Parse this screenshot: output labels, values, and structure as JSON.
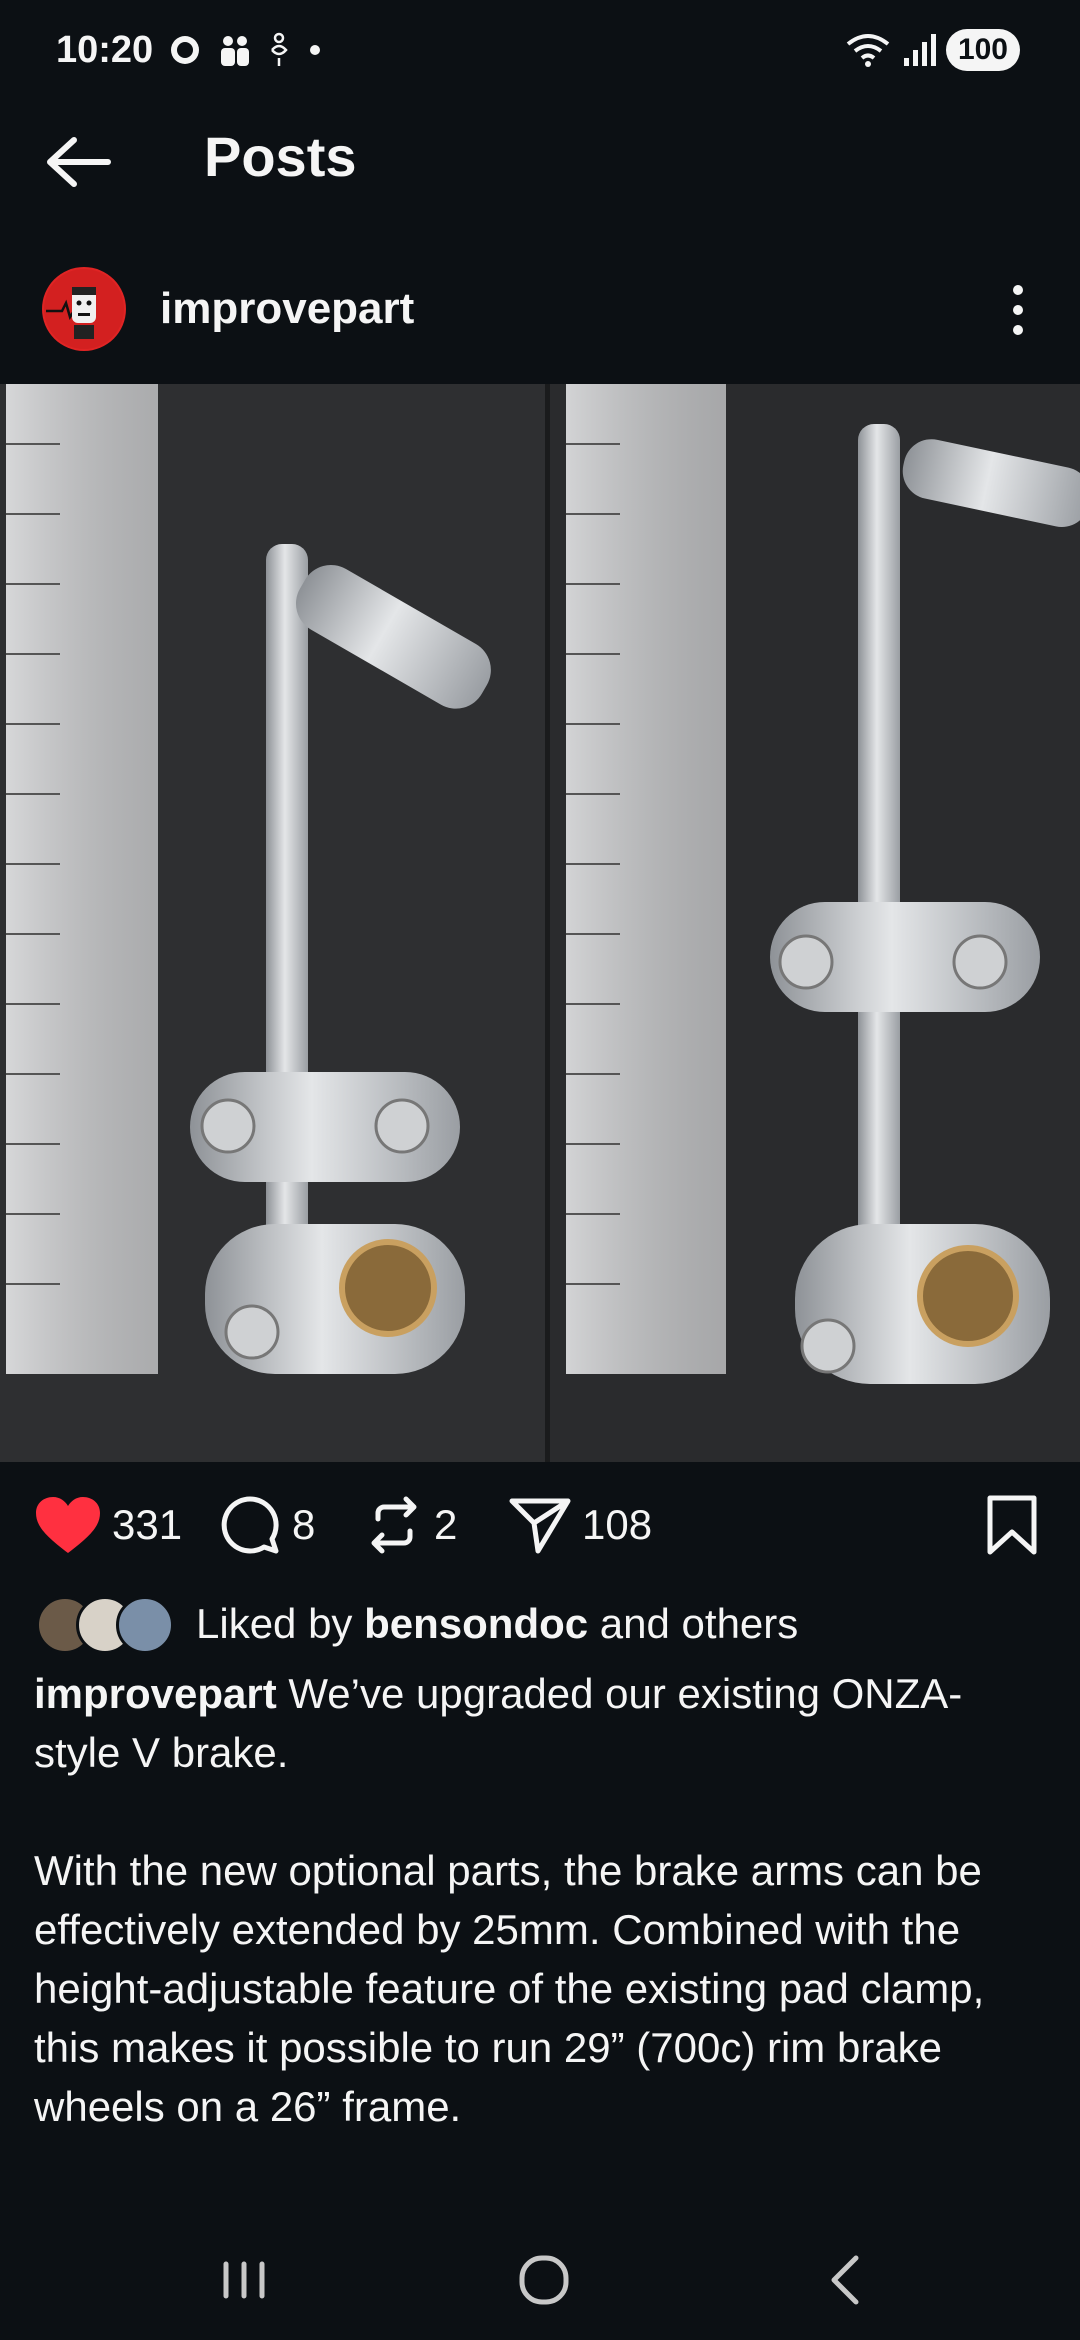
{
  "status_bar": {
    "time": "10:20",
    "battery": "100",
    "icons": [
      "chat-bubble-icon",
      "people-icon",
      "accessibility-icon",
      "dot-icon",
      "wifi-icon",
      "signal-icon"
    ]
  },
  "header": {
    "title": "Posts",
    "back_icon": "arrow-left-icon"
  },
  "post": {
    "author": "improvepart",
    "image_alt_icons": [
      "ruler",
      "brake-arm"
    ],
    "actions": {
      "likes": "331",
      "comments": "8",
      "reposts": "2",
      "shares": "108"
    },
    "liked_by": {
      "prefix": "Liked by ",
      "user": "bensondoc",
      "suffix": " and others"
    },
    "caption_author": "improvepart",
    "caption_text": " We’ve upgraded our existing ONZA-style V brake.\n\nWith the new optional parts, the brake arms can be effectively extended by 25mm. Combined with the height-adjustable feature of the existing pad clamp, this makes it possible to run 29” (700c) rim brake wheels on a 26” frame."
  },
  "colors": {
    "background": "#0c1014",
    "like_red": "#ff3040",
    "text": "#f5f5f5"
  }
}
